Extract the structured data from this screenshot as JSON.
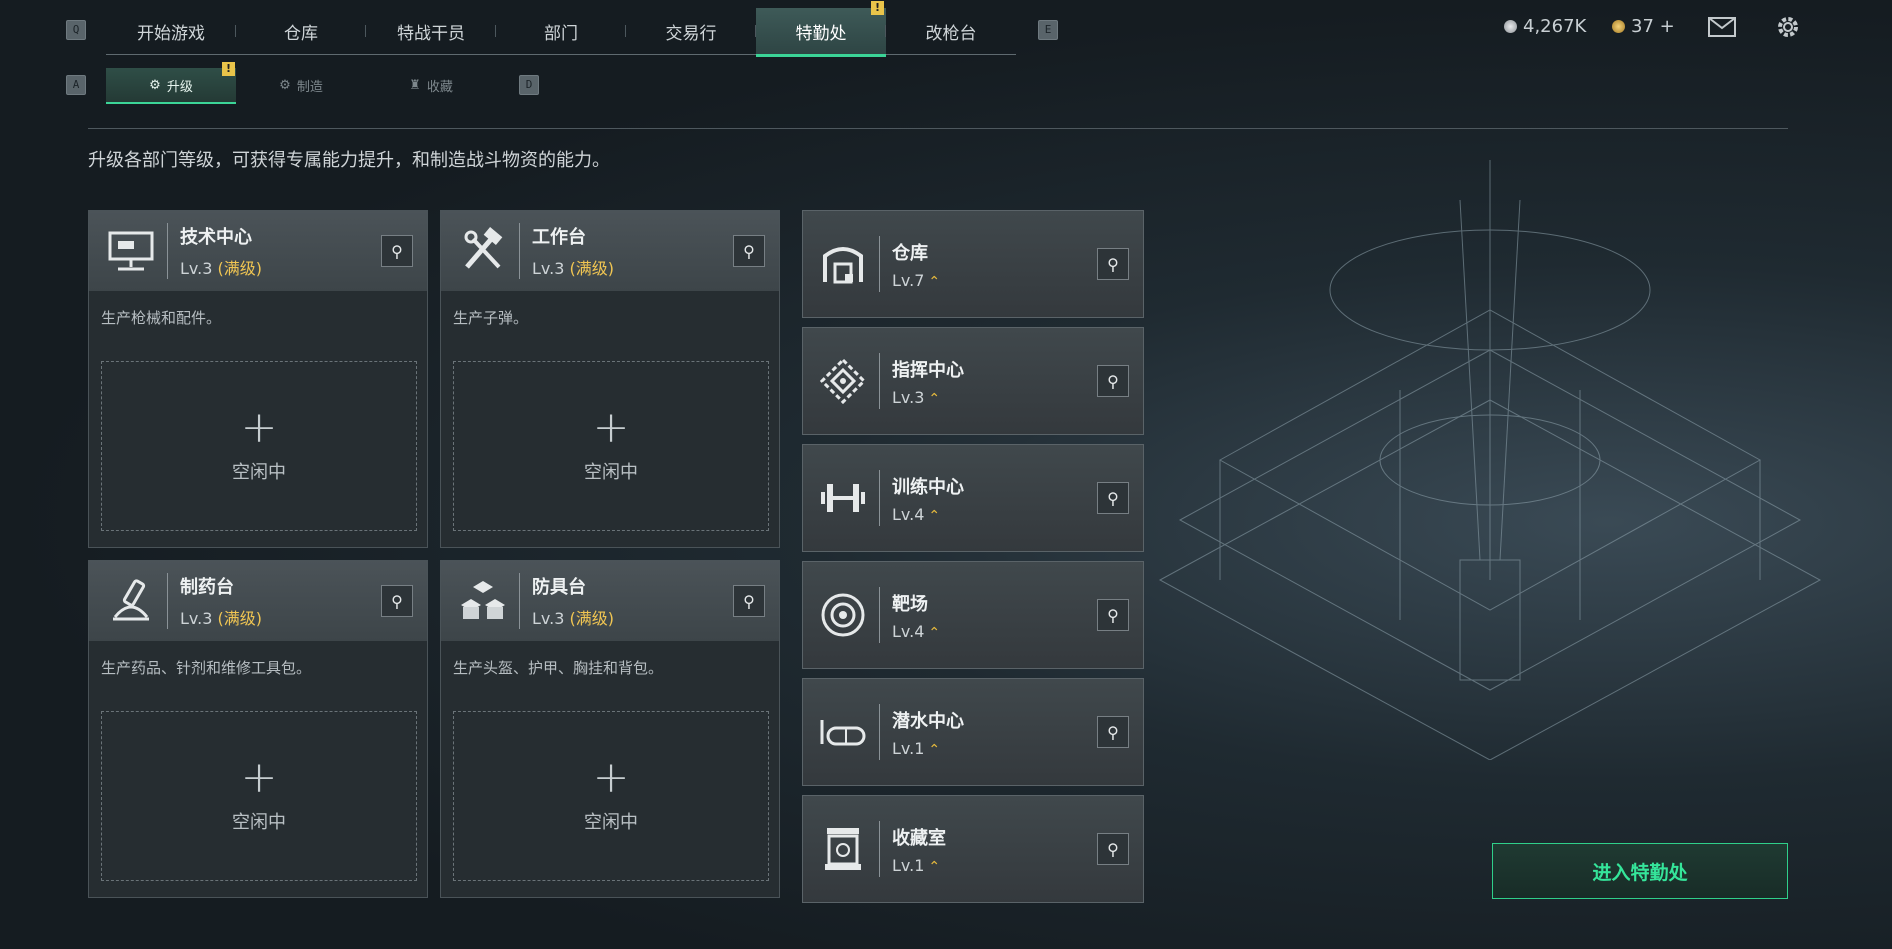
{
  "topbar": {
    "key_left": "Q",
    "key_right": "E",
    "tabs": [
      {
        "label": "开始游戏"
      },
      {
        "label": "仓库"
      },
      {
        "label": "特战干员"
      },
      {
        "label": "部门"
      },
      {
        "label": "交易行"
      },
      {
        "label": "特勤处",
        "active": true,
        "badge": "!"
      },
      {
        "label": "改枪台"
      }
    ],
    "currency_silver": "4,267K",
    "currency_gold": "37 +",
    "icons": [
      "mail-icon",
      "gear-icon"
    ]
  },
  "subnav": {
    "key_left": "A",
    "key_right": "D",
    "tabs": [
      {
        "label": "升级",
        "active": true,
        "badge": "!",
        "icon": "upgrade-icon"
      },
      {
        "label": "制造",
        "icon": "craft-icon"
      },
      {
        "label": "收藏",
        "icon": "collection-icon"
      }
    ]
  },
  "description": "升级各部门等级，可获得专属能力提升，和制造战斗物资的能力。",
  "workstations": [
    {
      "name": "技术中心",
      "level": "Lv.3",
      "max": "(满级)",
      "desc": "生产枪械和配件。",
      "slot_label": "空闲中",
      "icon": "tech-center-icon"
    },
    {
      "name": "工作台",
      "level": "Lv.3",
      "max": "(满级)",
      "desc": "生产子弹。",
      "slot_label": "空闲中",
      "icon": "workbench-icon"
    },
    {
      "name": "制药台",
      "level": "Lv.3",
      "max": "(满级)",
      "desc": "生产药品、针剂和维修工具包。",
      "slot_label": "空闲中",
      "icon": "pharmacy-icon"
    },
    {
      "name": "防具台",
      "level": "Lv.3",
      "max": "(满级)",
      "desc": "生产头盔、护甲、胸挂和背包。",
      "slot_label": "空闲中",
      "icon": "armor-bench-icon"
    }
  ],
  "facilities": [
    {
      "name": "仓库",
      "level": "Lv.7",
      "icon": "warehouse-icon"
    },
    {
      "name": "指挥中心",
      "level": "Lv.3",
      "icon": "command-center-icon"
    },
    {
      "name": "训练中心",
      "level": "Lv.4",
      "icon": "training-center-icon"
    },
    {
      "name": "靶场",
      "level": "Lv.4",
      "icon": "shooting-range-icon"
    },
    {
      "name": "潜水中心",
      "level": "Lv.1",
      "icon": "diving-center-icon"
    },
    {
      "name": "收藏室",
      "level": "Lv.1",
      "icon": "collection-room-icon"
    }
  ],
  "enter_button": "进入特勤处",
  "colors": {
    "accent": "#3bd497",
    "gold": "#f0c552",
    "badge": "#e9c44a"
  }
}
